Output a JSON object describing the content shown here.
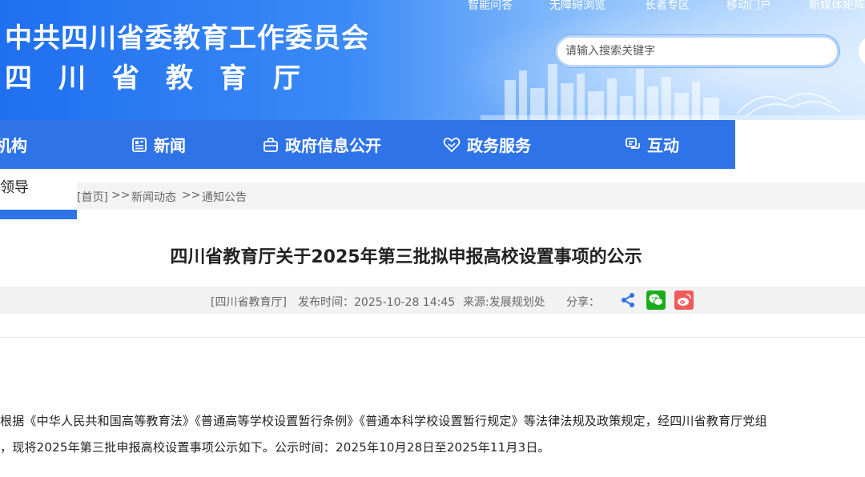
{
  "header": {
    "org_title": "中共四川省委教育工作委员会",
    "org_subtitle": "四川省教育厅",
    "top_links": [
      "智能问答",
      "无障碍浏览",
      "长者专区",
      "移动门户",
      "新媒体矩阵"
    ],
    "search_placeholder": "请输入搜索关键字"
  },
  "nav": {
    "items": [
      {
        "label": "机构",
        "icon": "org-icon"
      },
      {
        "label": "新闻",
        "icon": "news-icon"
      },
      {
        "label": "政府信息公开",
        "icon": "info-open-icon"
      },
      {
        "label": "政务服务",
        "icon": "service-icon"
      },
      {
        "label": "互动",
        "icon": "interaction-icon"
      }
    ]
  },
  "sidebar": {
    "item_label": "领导"
  },
  "breadcrumb": {
    "home": "[首页]",
    "sep1": ">>",
    "level1": "新闻动态",
    "sep2": ">>",
    "level2": "通知公告"
  },
  "article": {
    "title": "四川省教育厅关于2025年第三批拟申报高校设置事项的公示",
    "source_tag": "[四川省教育厅]",
    "publish_time": "发布时间：2025-10-28 14:45",
    "origin": "来源:发展规划处",
    "share_label": "分享：",
    "paragraph_line1": "根据《中华人民共和国高等教育法》《普通高等学校设置暂行条例》《普通本科学校设置暂行规定》等法律法规及政策规定，经四川省教育厅党组",
    "paragraph_line2": "，现将2025年第三批申报高校设置事项公示如下。公示时间：2025年10月28日至2025年11月3日。"
  },
  "colors": {
    "nav_bg": "#2f73e8",
    "wechat": "#1aad19",
    "weibo": "#f05a5a",
    "share": "#2f73e8"
  }
}
